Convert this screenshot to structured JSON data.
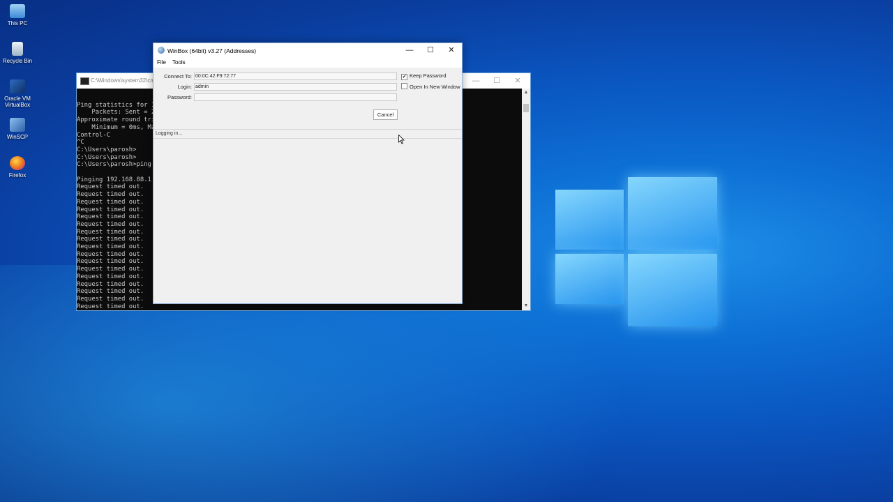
{
  "desktop": {
    "icons": [
      {
        "label": "This PC",
        "icon": "this-pc-icon",
        "color": "#7fb8ea"
      },
      {
        "label": "Recycle Bin",
        "icon": "recycle-bin-icon",
        "color": "#d6e4ef"
      },
      {
        "label": "Oracle VM VirtualBox",
        "icon": "virtualbox-icon",
        "color": "#1c5aa6"
      },
      {
        "label": "WinSCP",
        "icon": "winscp-icon",
        "color": "#5a8fd0"
      },
      {
        "label": "Firefox",
        "icon": "firefox-icon",
        "color": "#f07a1f"
      }
    ]
  },
  "cmd": {
    "title": "C:\\Windows\\system32\\cm",
    "lines": [
      "",
      "Ping statistics for 1",
      "    Packets: Sent = 2",
      "Approximate round tri",
      "    Minimum = 0ms, Ma",
      "Control-C",
      "^C",
      "C:\\Users\\parosh>",
      "C:\\Users\\parosh>",
      "C:\\Users\\parosh>ping",
      "",
      "Pinging 192.168.88.1",
      "Request timed out.",
      "Request timed out.",
      "Request timed out.",
      "Request timed out.",
      "Request timed out.",
      "Request timed out.",
      "Request timed out.",
      "Request timed out.",
      "Request timed out.",
      "Request timed out.",
      "Request timed out.",
      "Request timed out.",
      "Request timed out.",
      "Request timed out.",
      "Request timed out.",
      "Request timed out.",
      "Request timed out."
    ]
  },
  "winbox": {
    "title": "WinBox (64bit) v3.27 (Addresses)",
    "menu": {
      "file": "File",
      "tools": "Tools"
    },
    "connect_to_label": "Connect To:",
    "connect_to_value": "00:0C:42:F9:72:77",
    "login_label": "Login:",
    "login_value": "admin",
    "password_label": "Password:",
    "password_value": "",
    "keep_password_label": "Keep Password",
    "keep_password_checked": "✔",
    "open_new_window_label": "Open In New Window",
    "cancel_label": "Cancel",
    "status": "Logging in..."
  },
  "colors": {
    "accent": "#0a55bf",
    "window_border": "#8fb1da"
  }
}
